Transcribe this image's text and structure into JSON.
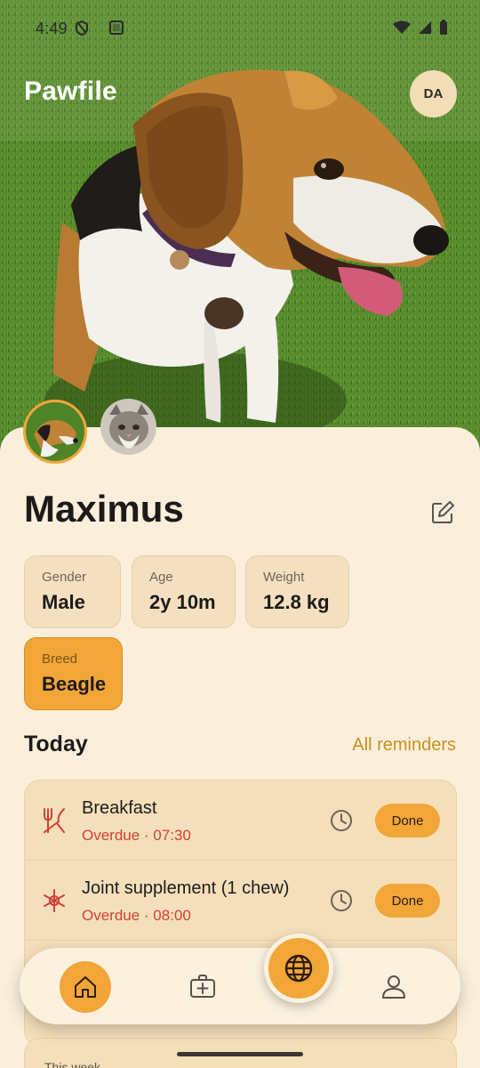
{
  "status_bar": {
    "time": "4:49"
  },
  "app": {
    "title": "Pawfile",
    "user_initials": "DA"
  },
  "pet": {
    "name": "Maximus",
    "stats": [
      {
        "label": "Gender",
        "value": "Male"
      },
      {
        "label": "Age",
        "value": "2y 10m"
      },
      {
        "label": "Weight",
        "value": "12.8 kg"
      },
      {
        "label": "Breed",
        "value": "Beagle"
      }
    ]
  },
  "today": {
    "heading": "Today",
    "link": "All reminders",
    "reminders": [
      {
        "title": "Breakfast",
        "status": "Overdue · 07:30",
        "icon": "fork-knife-icon",
        "action": "Done"
      },
      {
        "title": "Joint supplement (1 chew)",
        "status": "Overdue · 08:00",
        "icon": "medicine-icon",
        "action": "Done"
      }
    ]
  },
  "week": {
    "heading": "This week"
  },
  "nav": {
    "items": [
      "home-icon",
      "medical-kit-icon",
      "globe-icon",
      "person-icon"
    ]
  },
  "colors": {
    "accent": "#f2a638",
    "background": "#fbefdc",
    "card": "#f4dfbb",
    "overdue": "#cf4234",
    "link": "#cc8f1d"
  }
}
